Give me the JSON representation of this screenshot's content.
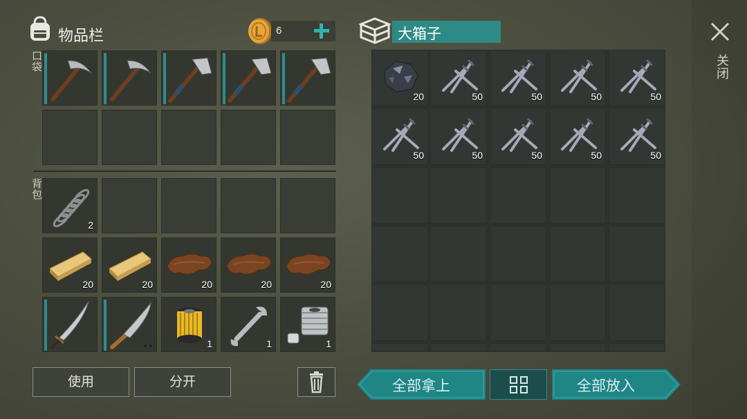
{
  "inventory": {
    "title": "物品栏",
    "coins": "6",
    "pocket_label": "口袋",
    "backpack_label": "背包",
    "pocket_slots": [
      {
        "icon": "pickaxe-icon",
        "count": ""
      },
      {
        "icon": "pickaxe-icon",
        "count": ""
      },
      {
        "icon": "hatchet-icon",
        "count": ""
      },
      {
        "icon": "hatchet-icon",
        "count": ""
      },
      {
        "icon": "hatchet-icon",
        "count": ""
      }
    ],
    "backpack_slots": [
      {
        "icon": "spring-icon",
        "count": "2"
      },
      {
        "icon": "plank-icon",
        "count": "20"
      },
      {
        "icon": "plank-icon",
        "count": "20"
      },
      {
        "icon": "leather-icon",
        "count": "20"
      },
      {
        "icon": "leather-icon",
        "count": "20"
      },
      {
        "icon": "leather-icon",
        "count": "20"
      },
      {
        "icon": "sword-icon",
        "count": ""
      },
      {
        "icon": "machete-icon",
        "count": ""
      },
      {
        "icon": "oil-filter-icon",
        "count": "1"
      },
      {
        "icon": "wrench-icon",
        "count": "1"
      },
      {
        "icon": "engine-cylinder-icon",
        "count": "1"
      }
    ],
    "use_button": "使用",
    "split_button": "分开"
  },
  "container": {
    "title": "大箱子",
    "slots": [
      {
        "icon": "iron-ore-icon",
        "count": "20"
      },
      {
        "icon": "nails-icon",
        "count": "50"
      },
      {
        "icon": "nails-icon",
        "count": "50"
      },
      {
        "icon": "nails-icon",
        "count": "50"
      },
      {
        "icon": "nails-icon",
        "count": "50"
      },
      {
        "icon": "nails-icon",
        "count": "50"
      },
      {
        "icon": "nails-icon",
        "count": "50"
      },
      {
        "icon": "nails-icon",
        "count": "50"
      },
      {
        "icon": "nails-icon",
        "count": "50"
      },
      {
        "icon": "nails-icon",
        "count": "50"
      }
    ],
    "take_all_button": "全部拿上",
    "put_all_button": "全部放入"
  },
  "close_label": "关闭",
  "colors": {
    "accent": "#1f8585",
    "teal_bar": "#2e8d8d",
    "coin": "#e2a43c"
  }
}
